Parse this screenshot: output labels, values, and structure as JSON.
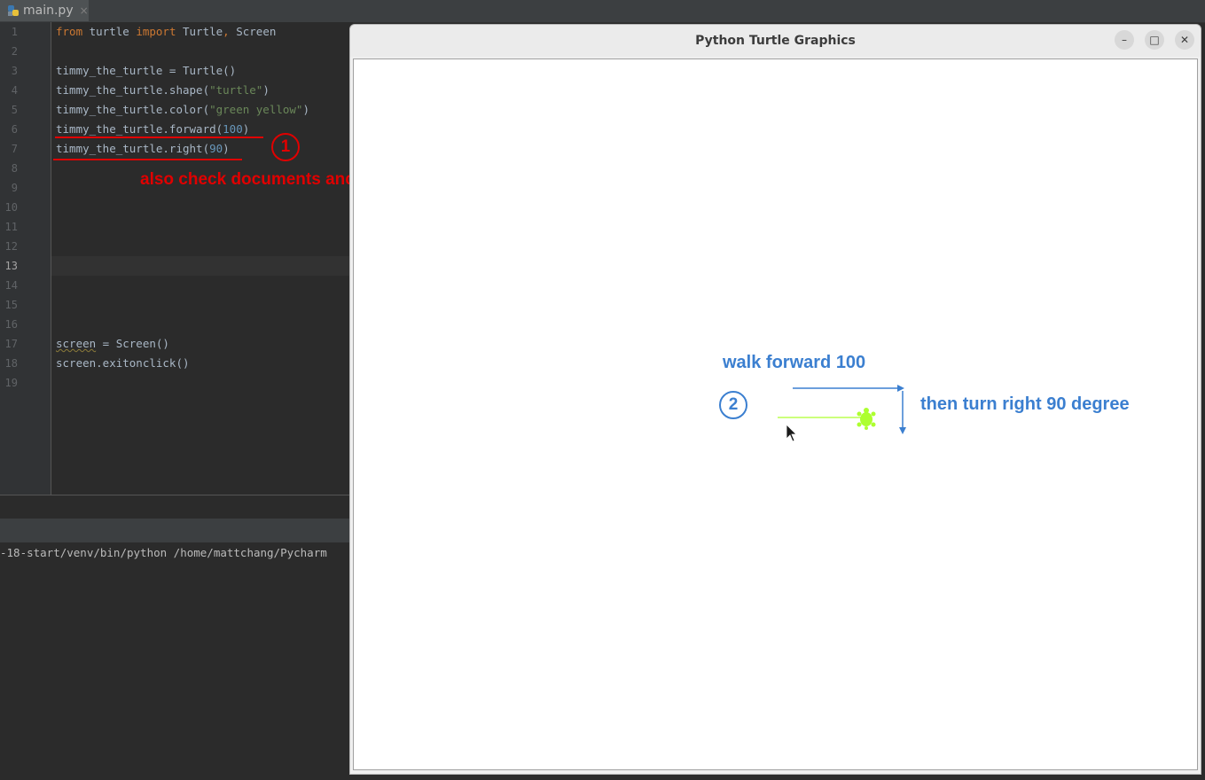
{
  "ide": {
    "tab_label": "main.py",
    "tab_close": "×",
    "line_numbers": [
      "1",
      "2",
      "3",
      "4",
      "5",
      "6",
      "7",
      "8",
      "9",
      "10",
      "11",
      "12",
      "13",
      "14",
      "15",
      "16",
      "17",
      "18",
      "19"
    ],
    "active_line": "13",
    "code": {
      "l1_from": "from",
      "l1_mod": " turtle ",
      "l1_import": "import",
      "l1_names": " Turtle",
      "l1_comma": ",",
      "l1_screen": " Screen",
      "l3": "timmy_the_turtle = Turtle()",
      "l4_pre": "timmy_the_turtle.shape(",
      "l4_str": "\"turtle\"",
      "l4_post": ")",
      "l5_pre": "timmy_the_turtle.color(",
      "l5_str": "\"green yellow\"",
      "l5_post": ")",
      "l6_pre": "timmy_the_turtle.forward(",
      "l6_num": "100",
      "l6_post": ")",
      "l7_pre": "timmy_the_turtle.right(",
      "l7_num": "90",
      "l7_post": ")",
      "l17_var": "screen",
      "l17_post": " = Screen()",
      "l18": "screen.exitonclick()"
    },
    "console_text": "-18-start/venv/bin/python /home/mattchang/Pycharm"
  },
  "annotations": {
    "step1": "1",
    "step1_note": "also check documents and google to find the way",
    "step2": "2",
    "walk_label": "walk forward 100",
    "turn_label": "then turn right 90 degree",
    "red": "#e00000",
    "blue": "#3b7fd0"
  },
  "turtle_window": {
    "title": "Python Turtle Graphics",
    "minimize": "–",
    "maximize": "□",
    "close": "✕",
    "pen_color": "#adff2f"
  }
}
